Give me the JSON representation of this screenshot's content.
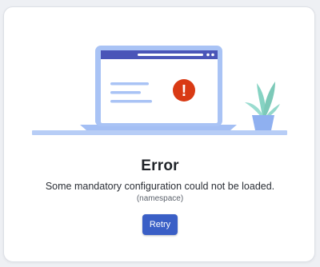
{
  "error": {
    "title": "Error",
    "message": "Some mandatory configuration could not be loaded.",
    "detail": "(namespace)",
    "retry_label": "Retry"
  },
  "illustration": {
    "alert_symbol": "!",
    "icons": [
      "laptop-illustration",
      "alert-icon",
      "plant-illustration"
    ]
  },
  "colors": {
    "accent": "#3a5fc6",
    "laptop_frame": "#a9c3f5",
    "laptop_header": "#4a55b8",
    "alert": "#d93a14",
    "leaf": "#86d3c3",
    "pot": "#8fb0f0"
  }
}
